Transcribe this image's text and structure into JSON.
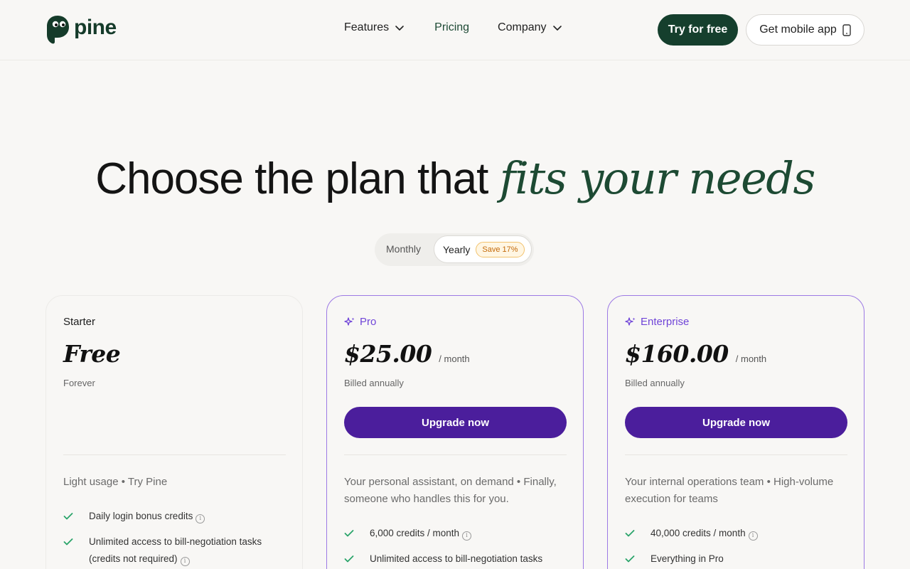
{
  "header": {
    "brand": "pine",
    "nav": [
      {
        "label": "Features"
      },
      {
        "label": "Pricing"
      },
      {
        "label": "Company"
      }
    ],
    "try_label": "Try for free",
    "mobile_label": "Get mobile app"
  },
  "hero": {
    "title_plain": "Choose the plan that",
    "title_accent": "fits your needs"
  },
  "billing_toggle": {
    "monthly": "Monthly",
    "yearly": "Yearly",
    "save_badge": "Save 17%",
    "selected": "Yearly"
  },
  "colors": {
    "brand_green": "#153f2d",
    "accent_purple": "#4b1e9c",
    "plan_purple": "#7045d8",
    "check_green": "#2aa46a"
  },
  "plans": [
    {
      "name": "Starter",
      "price": "Free",
      "per": "",
      "billing": "Forever",
      "cta": "",
      "description": "Light usage • Try Pine",
      "features": [
        {
          "text": "Daily login bonus credits",
          "info": true
        },
        {
          "text": "Unlimited access to bill-negotiation tasks (credits not required)",
          "info": true
        }
      ]
    },
    {
      "name": "Pro",
      "price": "$25.00",
      "per": "/ month",
      "billing": "Billed annually",
      "cta": "Upgrade now",
      "description": "Your personal assistant, on demand • Finally, someone who handles this for you.",
      "features": [
        {
          "text": "6,000 credits / month",
          "info": true
        },
        {
          "text": "Unlimited access to bill-negotiation tasks",
          "info": false
        }
      ]
    },
    {
      "name": "Enterprise",
      "price": "$160.00",
      "per": "/ month",
      "billing": "Billed annually",
      "cta": "Upgrade now",
      "description": "Your internal operations team • High-volume execution for teams",
      "features": [
        {
          "text": "40,000 credits / month",
          "info": true
        },
        {
          "text": "Everything in Pro",
          "info": false
        }
      ]
    }
  ]
}
